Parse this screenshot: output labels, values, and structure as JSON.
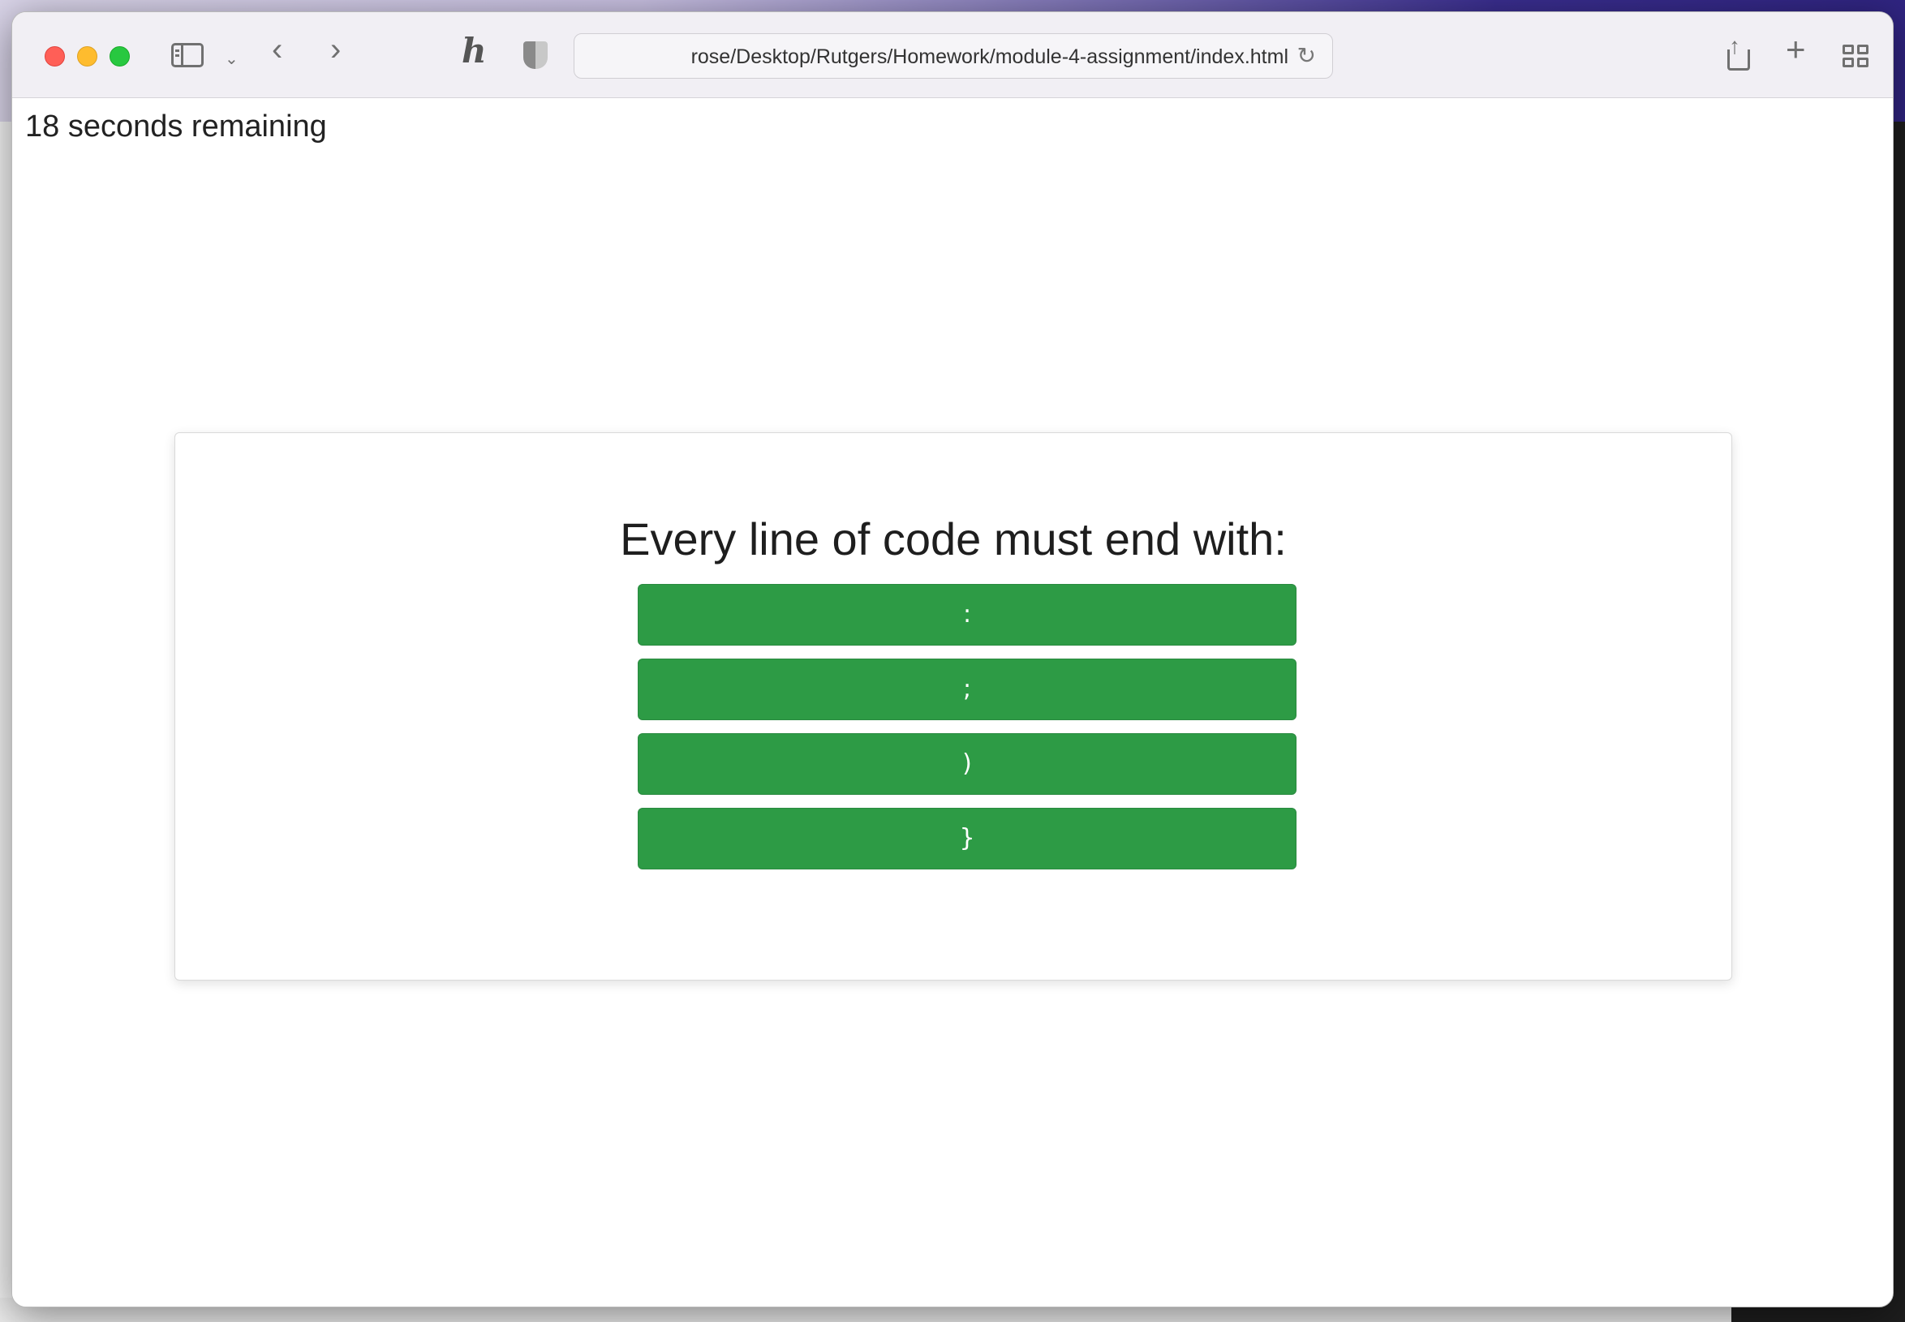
{
  "browser": {
    "address_url": "rose/Desktop/Rutgers/Homework/module-4-assignment/index.html"
  },
  "quiz": {
    "timer_text": "18 seconds remaining",
    "question": "Every line of code must end with:",
    "answers": [
      ":",
      ";",
      ")",
      "}"
    ],
    "button_color": "#2d9b45"
  },
  "icons": {
    "sidebar": "sidebar-icon",
    "back": "chevron-left-icon",
    "forward": "chevron-right-icon",
    "honey_extension": "honey-icon",
    "privacy": "shield-icon",
    "reload": "reload-icon",
    "share": "share-icon",
    "new_tab": "plus-icon",
    "tab_overview": "tab-grid-icon"
  }
}
